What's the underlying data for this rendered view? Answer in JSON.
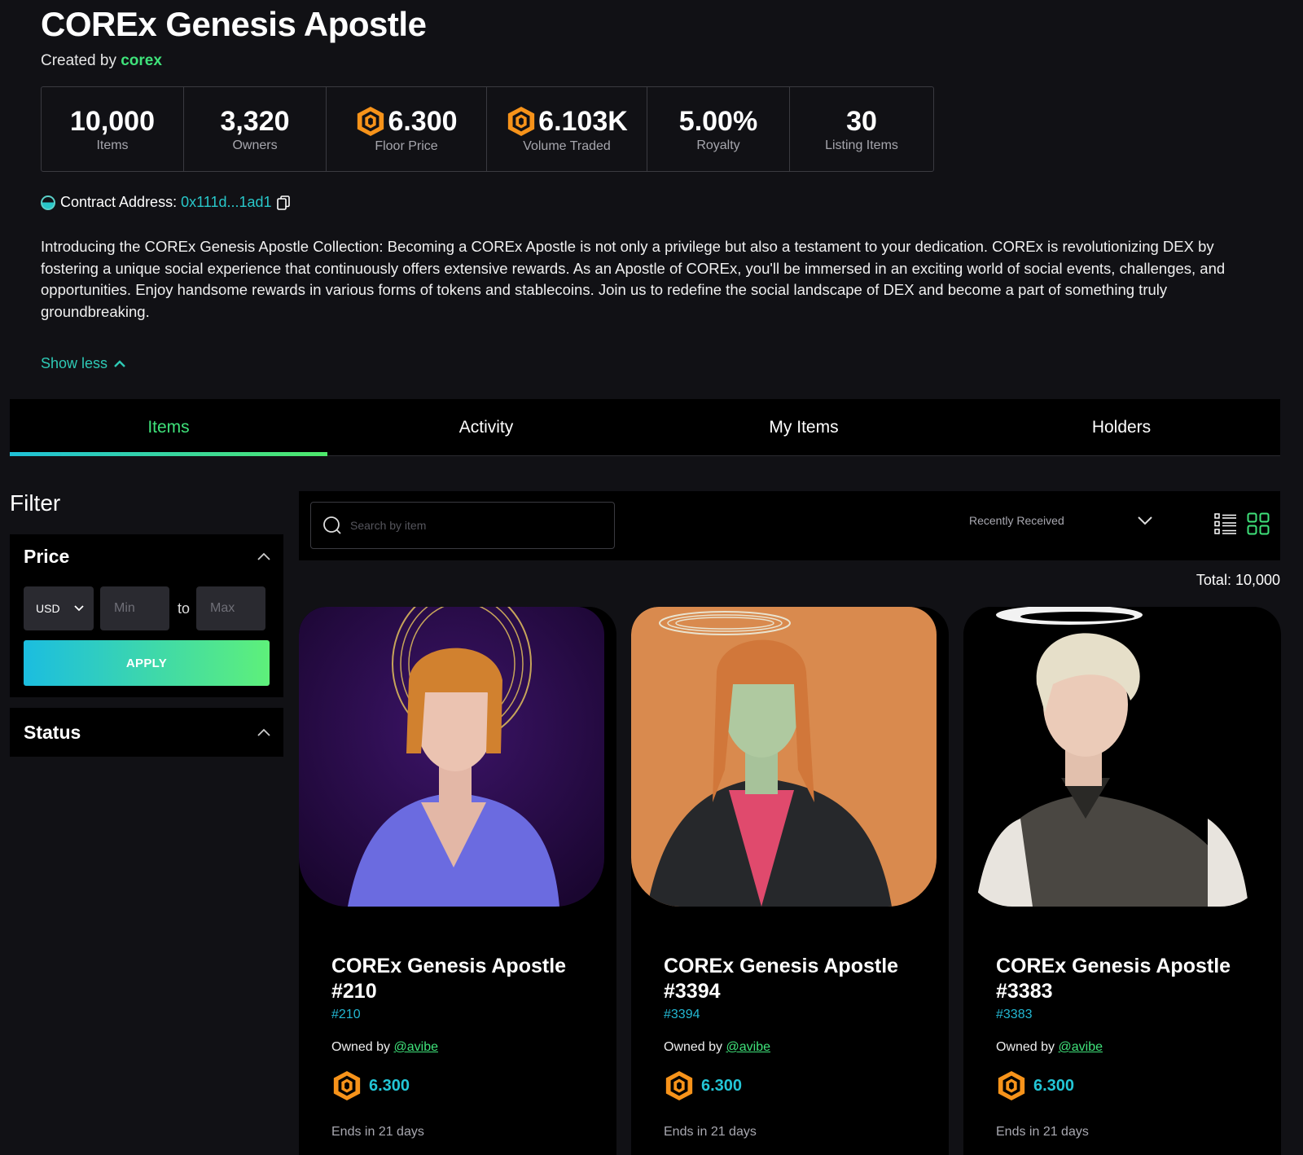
{
  "collection": {
    "title": "COREx Genesis Apostle",
    "created_by_label": "Created by",
    "creator": "corex"
  },
  "stats": [
    {
      "value": "10,000",
      "label": "Items",
      "icon": ""
    },
    {
      "value": "3,320",
      "label": "Owners",
      "icon": ""
    },
    {
      "value": "6.300",
      "label": "Floor Price",
      "icon": "core-coin-icon"
    },
    {
      "value": "6.103K",
      "label": "Volume Traded",
      "icon": "core-coin-icon"
    },
    {
      "value": "5.00%",
      "label": "Royalty",
      "icon": ""
    },
    {
      "value": "30",
      "label": "Listing Items",
      "icon": ""
    }
  ],
  "contract": {
    "label": "Contract Address:",
    "address": "0x111d...1ad1"
  },
  "description": "Introducing the COREx Genesis Apostle Collection: Becoming a COREx Apostle is not only a privilege but also a testament to your dedication. COREx is revolutionizing DEX by fostering a unique social experience that continuously offers extensive rewards. As an Apostle of COREx, you'll be immersed in an exciting world of social events, challenges, and opportunities. Enjoy handsome rewards in various forms of tokens and stablecoins. Join us to redefine the social landscape of DEX and become a part of something truly groundbreaking.",
  "show_less": "Show less",
  "tabs": [
    {
      "label": "Items",
      "active": true
    },
    {
      "label": "Activity",
      "active": false
    },
    {
      "label": "My Items",
      "active": false
    },
    {
      "label": "Holders",
      "active": false
    }
  ],
  "filter": {
    "title": "Filter",
    "price": {
      "title": "Price",
      "currency": "USD",
      "min_placeholder": "Min",
      "to": "to",
      "max_placeholder": "Max",
      "apply": "APPLY"
    },
    "status": {
      "title": "Status"
    }
  },
  "toolbar": {
    "search_placeholder": "Search by item",
    "sort": "Recently Received",
    "total": "Total: 10,000"
  },
  "colors": {
    "accent_green": "#3fe27a",
    "accent_cyan": "#23b7d2",
    "background": "#111115",
    "coin_orange": "#f7931a"
  },
  "items": [
    {
      "name": "COREx Genesis Apostle #210",
      "id": "#210",
      "owned_label": "Owned by",
      "owner": "@avibe",
      "price": "6.300",
      "ends": "Ends in 21 days",
      "bg": "#2a0d4a"
    },
    {
      "name": "COREx Genesis Apostle #3394",
      "id": "#3394",
      "owned_label": "Owned by",
      "owner": "@avibe",
      "price": "6.300",
      "ends": "Ends in 21 days",
      "bg": "#d98a4e"
    },
    {
      "name": "COREx Genesis Apostle #3383",
      "id": "#3383",
      "owned_label": "Owned by",
      "owner": "@avibe",
      "price": "6.300",
      "ends": "Ends in 21 days",
      "bg": "#000000"
    }
  ]
}
